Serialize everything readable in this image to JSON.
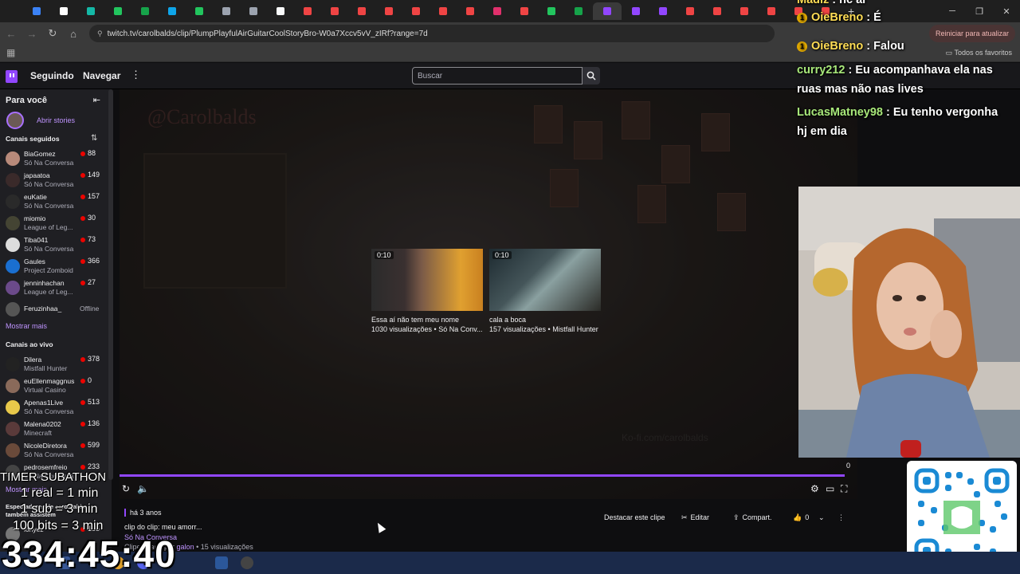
{
  "browser": {
    "url": "twitch.tv/carolbalds/clip/PlumpPlayfulAirGuitarCoolStoryBro-W0a7Xccv5vV_zIRf?range=7d",
    "restart_label": "Reiniciar para atualizar",
    "all_favorites": "Todos os favoritos",
    "tab_colors": [
      "#3b82f6",
      "#fff",
      "#14b8a6",
      "#22c55e",
      "#16a34a",
      "#0ea5e9",
      "#22c55e",
      "#9ca3af",
      "#9ca3af",
      "#f9fafb",
      "#ef4444",
      "#ef4444",
      "#ef4444",
      "#ef4444",
      "#ef4444",
      "#ef4444",
      "#ef4444",
      "#e1306c",
      "#ef4444",
      "#22c55e",
      "#16a34a",
      "#9146ff",
      "#9146ff",
      "#9146ff",
      "#ef4444",
      "#ef4444",
      "#ef4444",
      "#ef4444",
      "#ef4444",
      "#ef4444"
    ]
  },
  "nav": {
    "following": "Seguindo",
    "browse": "Navegar",
    "search_placeholder": "Buscar"
  },
  "sidebar": {
    "for_you": "Para você",
    "stories": "Abrir stories",
    "followed_title": "Canais seguidos",
    "followed": [
      {
        "name": "BiaGomez",
        "game": "Só Na Conversa",
        "viewers": "88",
        "color": "#b88a7a"
      },
      {
        "name": "japaatoa",
        "game": "Só Na Conversa",
        "viewers": "149",
        "color": "#3a2a2a"
      },
      {
        "name": "euKatie",
        "game": "Só Na Conversa",
        "viewers": "157",
        "color": "#2a2a2a"
      },
      {
        "name": "miomio",
        "game": "League of Leg...",
        "viewers": "30",
        "color": "#443"
      },
      {
        "name": "Tiba041",
        "game": "Só Na Conversa",
        "viewers": "73",
        "color": "#ddd"
      },
      {
        "name": "Gaules",
        "game": "Project Zomboid",
        "viewers": "366",
        "color": "#1a6fd1"
      },
      {
        "name": "jenninhachan",
        "game": "League of Leg...",
        "viewers": "27",
        "color": "#6b4a8a"
      },
      {
        "name": "Feruzinhaa_",
        "game": "",
        "viewers": "Offline",
        "color": "#555"
      }
    ],
    "show_more": "Mostrar mais",
    "live_title": "Canais ao vivo",
    "live": [
      {
        "name": "Dilera",
        "game": "Mistfall Hunter",
        "viewers": "378",
        "color": "#222"
      },
      {
        "name": "euEllenmaggnus",
        "game": "Virtual Casino",
        "viewers": "0",
        "color": "#8a6a5a"
      },
      {
        "name": "Apenas1Live",
        "game": "Só Na Conversa",
        "viewers": "513",
        "color": "#e8c84a"
      },
      {
        "name": "Malena0202",
        "game": "Minecraft",
        "viewers": "136",
        "color": "#5a3a3a"
      },
      {
        "name": "NicoleDiretora",
        "game": "Só Na Conversa",
        "viewers": "599",
        "color": "#6a4a3a"
      },
      {
        "name": "pedrosemfreio",
        "game": "Só Na Conversa",
        "viewers": "233",
        "color": "#444"
      }
    ],
    "show_more_2": "Mostrar mais",
    "viewers_also": "Espectadores de carolbalds também assistem",
    "viewers_also_item": {
      "name": "lonyez",
      "viewers": "185"
    }
  },
  "player": {
    "watermark": "@Carolbalds",
    "kofi": "Ko-fi.com/carolbalds",
    "progress_time": "0",
    "recs": [
      {
        "time": "0:10",
        "title": "Essa aí não tem meu nome",
        "meta": "1030 visualizações • Só Na Conv..."
      },
      {
        "time": "0:10",
        "title": "cala a boca",
        "meta": "157 visualizações • Mistfall Hunter"
      }
    ]
  },
  "clip": {
    "age": "há 3 anos",
    "title": "clip do clip: meu amorr...",
    "category": "Só Na Conversa",
    "creator_prefix": "Clipe criado por",
    "creator": "galon",
    "views": "15 visualizações",
    "highlight": "Destacar este clipe",
    "edit": "Editar",
    "share": "Compart.",
    "likes": "0"
  },
  "overlay": {
    "chat": [
      {
        "user": "Madiz",
        "msg": "hc ai",
        "color": "#ffdd55",
        "badge": false
      },
      {
        "user": "OieBreno",
        "msg": "É",
        "color": "#ffdd55",
        "badge": true
      },
      {
        "user": "OieBreno",
        "msg": "Falou",
        "color": "#ffdd55",
        "badge": true
      },
      {
        "user": "curry212",
        "msg": "Eu acompanhava ela nas",
        "color": "#a8e87a",
        "badge": false
      },
      {
        "user": "",
        "msg": "ruas mas não nas lives",
        "color": "#fff",
        "badge": false
      },
      {
        "user": "LucasMatney98",
        "msg": "Eu tenho vergonha",
        "color": "#a8e87a",
        "badge": false
      },
      {
        "user": "",
        "msg": "hj em dia",
        "color": "#fff",
        "badge": false
      }
    ],
    "subathon_title": "TIMER SUBATHON",
    "sub_rules": [
      "1 real = 1 min",
      "1 sub = 3 min",
      "100 bits = 3 min"
    ],
    "timer": "334:45:40"
  }
}
